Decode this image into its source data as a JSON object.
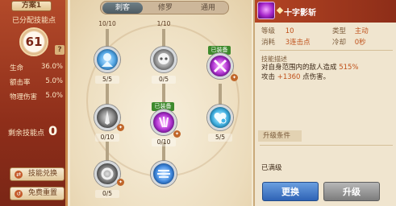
{
  "left": {
    "plan_badge": "方案1",
    "alloc_label": "已分配技能点",
    "allocated_points": "61",
    "stats": [
      {
        "label": "生命",
        "value": "36.0%"
      },
      {
        "label": "额击率",
        "value": "5.0%"
      },
      {
        "label": "物理伤害",
        "value": "5.0%"
      }
    ],
    "remain_label": "剩余技能点",
    "remain_value": "0",
    "buttons": [
      {
        "label": "技能兑换"
      },
      {
        "label": "免费重置"
      }
    ]
  },
  "tabs": [
    {
      "label": "刺客",
      "active": true
    },
    {
      "label": "修罗",
      "active": false
    },
    {
      "label": "通用",
      "active": false
    }
  ],
  "tree": {
    "top_labels": [
      "10/10",
      "1/10"
    ],
    "equipped_label": "已装备",
    "nodes": [
      {
        "level": "5/5",
        "color": "#4fa6e8",
        "icon": "crystal-icon"
      },
      {
        "level": "0/5",
        "color": "#9a9a9a",
        "icon": "skull-icon"
      },
      {
        "level": "",
        "color": "#b02fd4",
        "icon": "cross-slash-icon",
        "equipped": true
      },
      {
        "level": "0/10",
        "color": "#7a7a7a",
        "icon": "blade-icon"
      },
      {
        "level": "0/10",
        "color": "#b02fd4",
        "icon": "claw-icon",
        "equipped": true
      },
      {
        "level": "5/5",
        "color": "#3fb3e6",
        "icon": "heart-icon"
      },
      {
        "level": "0/5",
        "color": "#7a7a7a",
        "icon": "spin-icon"
      },
      {
        "level": "",
        "color": "#3f8ce6",
        "icon": "wind-icon"
      }
    ]
  },
  "right": {
    "skill_name": "十字影斩",
    "level_label": "等级",
    "level_value": "10",
    "type_label": "类型",
    "type_value": "主动",
    "cost_label": "消耗",
    "cost_value": "3连击点",
    "cooldown_label": "冷却",
    "cooldown_value": "0秒",
    "desc_title": "技能描述",
    "desc_line1_a": "对自身范围内的敌人造成 ",
    "desc_line1_b": "515%",
    "desc_line2_a": "攻击 ",
    "desc_line2_b": "+1360",
    "desc_line2_c": " 点伤害。",
    "upgrade_cond": "升级条件",
    "maxed": "已满级",
    "swap_button": "更换",
    "upgrade_button": "升级"
  }
}
